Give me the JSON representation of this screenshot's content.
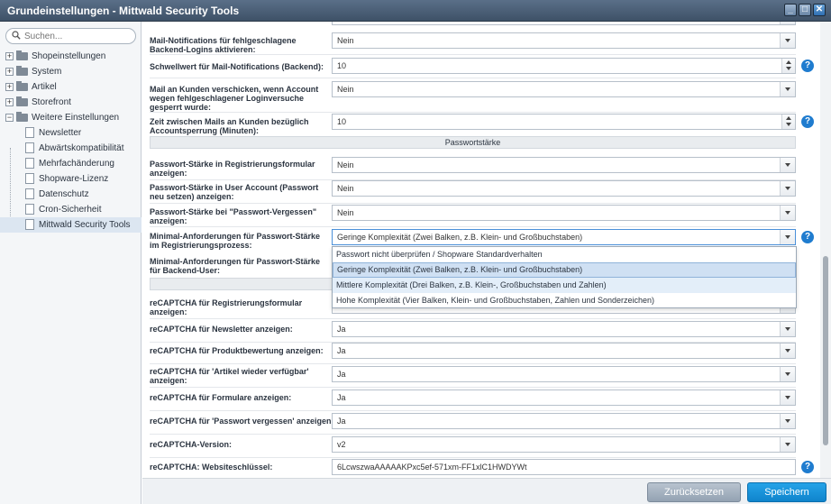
{
  "window": {
    "title": "Grundeinstellungen - Mittwald Security Tools",
    "buttons": {
      "minimize": "_",
      "maximize": "□",
      "close": "✕"
    }
  },
  "sidebar": {
    "search_placeholder": "Suchen...",
    "items": [
      {
        "label": "Shopeinstellungen",
        "type": "folder",
        "expanded": false
      },
      {
        "label": "System",
        "type": "folder",
        "expanded": false
      },
      {
        "label": "Artikel",
        "type": "folder",
        "expanded": false
      },
      {
        "label": "Storefront",
        "type": "folder",
        "expanded": false
      },
      {
        "label": "Weitere Einstellungen",
        "type": "folder",
        "expanded": true
      },
      {
        "label": "Newsletter",
        "type": "leaf"
      },
      {
        "label": "Abwärtskompatibilität",
        "type": "leaf"
      },
      {
        "label": "Mehrfachänderung",
        "type": "leaf"
      },
      {
        "label": "Shopware-Lizenz",
        "type": "leaf"
      },
      {
        "label": "Datenschutz",
        "type": "leaf"
      },
      {
        "label": "Cron-Sicherheit",
        "type": "leaf"
      },
      {
        "label": "Mittwald Security Tools",
        "type": "leaf",
        "selected": true
      }
    ]
  },
  "form": {
    "rows": [
      {
        "label": "Mail-Notifications für fehlgeschlagene Backend-Logins aktivieren:",
        "value": "Nein",
        "control": "select",
        "help": false
      },
      {
        "label": "Schwellwert für Mail-Notifications (Backend):",
        "value": "10",
        "control": "number",
        "help": true
      },
      {
        "label": "Mail an Kunden verschicken, wenn Account wegen fehlgeschlagener Loginversuche gesperrt wurde:",
        "value": "Nein",
        "control": "select",
        "help": false
      },
      {
        "label": "Zeit zwischen Mails an Kunden bezüglich Accountsperrung (Minuten):",
        "value": "10",
        "control": "number",
        "help": true
      },
      {
        "label": "Passwort-Stärke in Registrierungsformular anzeigen:",
        "value": "Nein",
        "control": "select",
        "help": false
      },
      {
        "label": "Passwort-Stärke in User Account (Passwort neu setzen) anzeigen:",
        "value": "Nein",
        "control": "select",
        "help": false
      },
      {
        "label": "Passwort-Stärke bei \"Passwort-Vergessen\" anzeigen:",
        "value": "Nein",
        "control": "select",
        "help": false
      },
      {
        "label": "Minimal-Anforderungen für Passwort-Stärke im Registrierungsprozess:",
        "value": "Geringe Komplexität (Zwei Balken, z.B. Klein- und Großbuchstaben)",
        "control": "select",
        "help": true,
        "open": true
      },
      {
        "label": "Minimal-Anforderungen für Passwort-Stärke für Backend-User:",
        "value": "",
        "control": "select",
        "help": false
      },
      {
        "label": "reCAPTCHA für Registrierungsformular anzeigen:",
        "value": "",
        "control": "select",
        "help": false
      },
      {
        "label": "reCAPTCHA für Newsletter anzeigen:",
        "value": "Ja",
        "control": "select",
        "help": false
      },
      {
        "label": "reCAPTCHA für Produktbewertung anzeigen:",
        "value": "Ja",
        "control": "select",
        "help": false
      },
      {
        "label": "reCAPTCHA für 'Artikel wieder verfügbar' anzeigen:",
        "value": "Ja",
        "control": "select",
        "help": false
      },
      {
        "label": "reCAPTCHA für Formulare anzeigen:",
        "value": "Ja",
        "control": "select",
        "help": false
      },
      {
        "label": "reCAPTCHA für 'Passwort vergessen' anzeigen:",
        "value": "Ja",
        "control": "select",
        "help": false
      },
      {
        "label": "reCAPTCHA-Version:",
        "value": "v2",
        "control": "select",
        "help": false
      },
      {
        "label": "reCAPTCHA: Websiteschlüssel:",
        "value": "6LcwszwaAAAAAKPxc5ef-571xm-FF1xlC1HWDYWt",
        "control": "text",
        "help": true
      }
    ],
    "section_title": "Passwortstärke",
    "dropdown_options": [
      "Passwort nicht überprüfen / Shopware Standardverhalten",
      "Geringe Komplexität (Zwei Balken, z.B. Klein- und Großbuchstaben)",
      "Mittlere Komplexität (Drei Balken, z.B. Klein-, Großbuchstaben und Zahlen)",
      "Hohe Komplexität (Vier Balken, Klein- und Großbuchstaben, Zahlen und Sonderzeichen)"
    ],
    "dropdown_selected_index": 1,
    "dropdown_hover_index": 2
  },
  "footer": {
    "reset_label": "Zurücksetzen",
    "save_label": "Speichern"
  },
  "colors": {
    "accent": "#1f7ccf",
    "save_button": "#1591d8",
    "titlebar": "#4a5d74"
  },
  "icons": {
    "help": "?",
    "search": "search-icon"
  }
}
